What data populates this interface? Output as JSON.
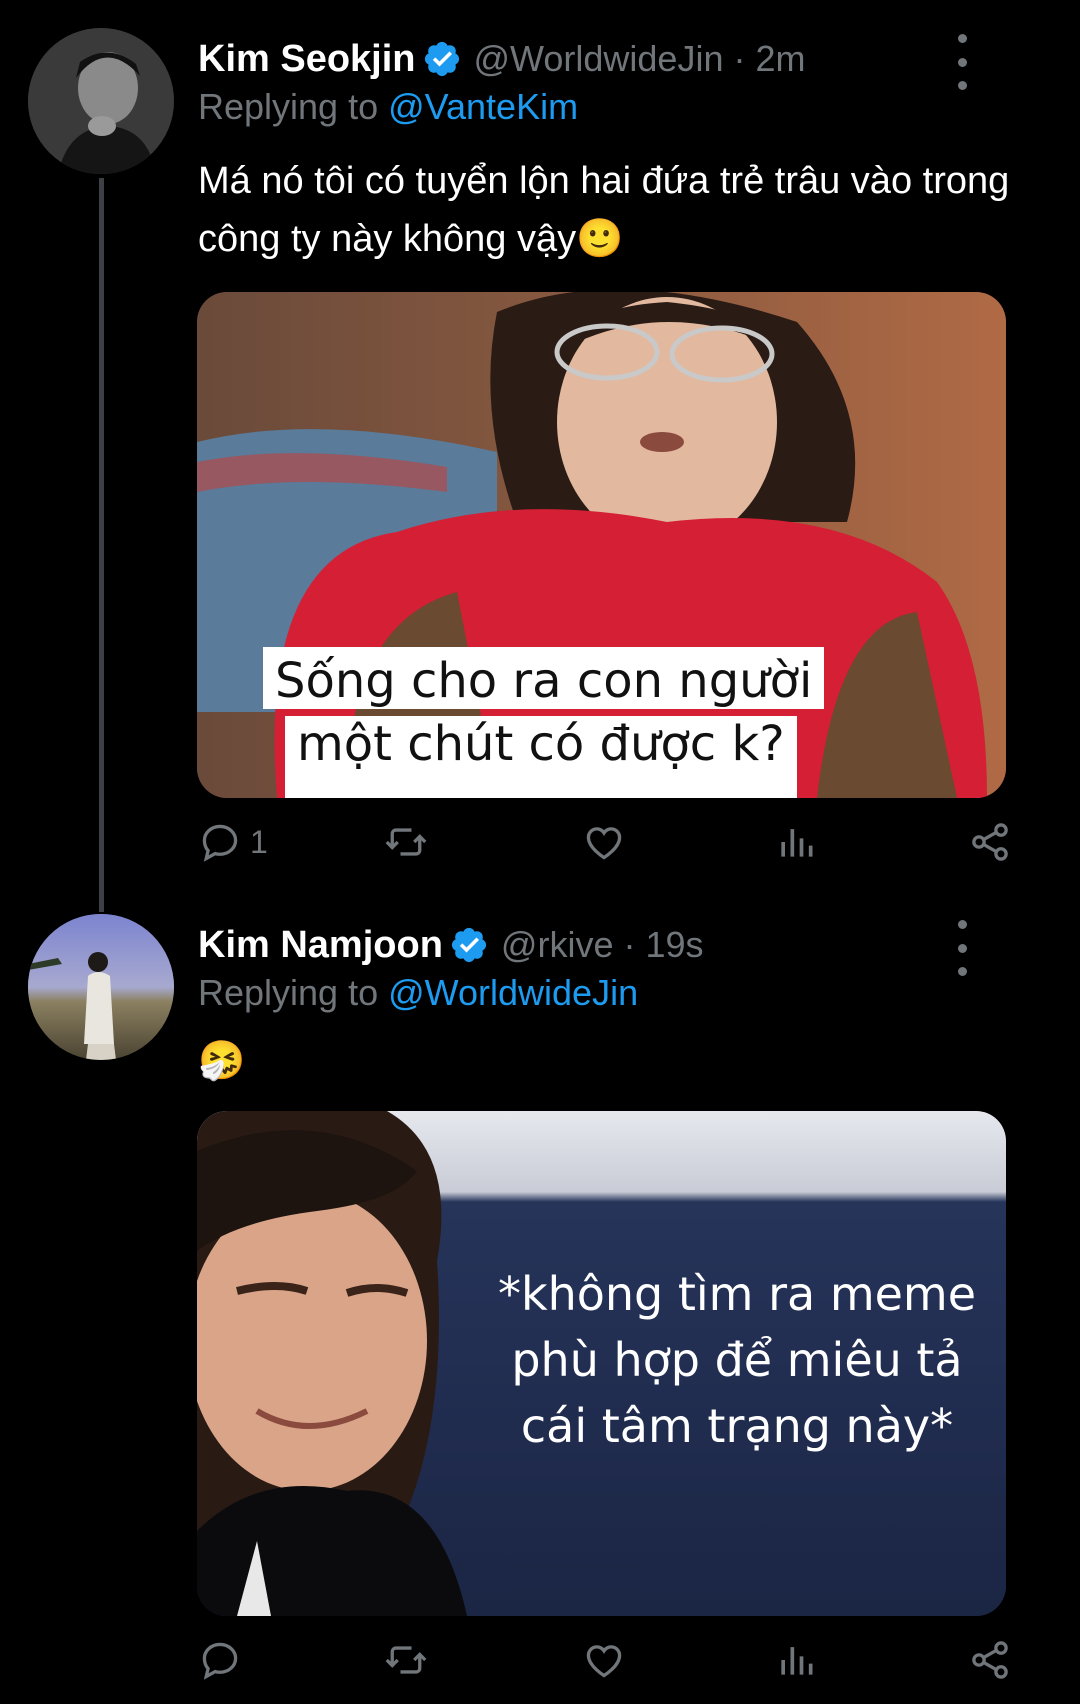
{
  "tweets": [
    {
      "name": "Kim Seokjin",
      "handle": "@WorldwideJin · 2m",
      "replying_label": "Replying to",
      "replying_to": "@VanteKim",
      "text": "Má nó tôi có tuyển lộn hai đứa trẻ trâu vào trong công ty này không vậy🙂",
      "media_caption_line1": "Sống cho ra con người",
      "media_caption_line2": "một chút có được k?",
      "reply_count": "1",
      "icons": [
        "reply-icon",
        "retweet-icon",
        "like-icon",
        "analytics-icon",
        "share-icon"
      ]
    },
    {
      "name": "Kim Namjoon",
      "handle": "@rkive · 19s",
      "replying_label": "Replying to",
      "replying_to": "@WorldwideJin",
      "text": "🤧",
      "media_caption_line1": "*không tìm ra meme",
      "media_caption_line2": "phù hợp để miêu tả",
      "media_caption_line3": "cái tâm trạng này*",
      "reply_count": "",
      "icons": [
        "reply-icon",
        "retweet-icon",
        "like-icon",
        "analytics-icon",
        "share-icon"
      ]
    }
  ],
  "colors": {
    "background": "#000000",
    "text": "#ffffff",
    "muted": "#71767b",
    "link": "#1d9bf0",
    "verified": "#1d9bf0",
    "thread_line": "#3d4146"
  }
}
